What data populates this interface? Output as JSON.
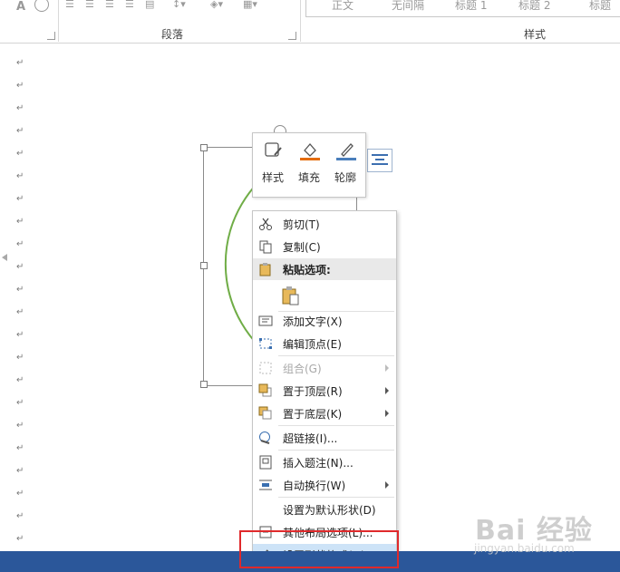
{
  "ribbon": {
    "paragraph_label": "段落",
    "styles_label": "样式",
    "style_items": [
      "正文",
      "无间隔",
      "标题 1",
      "标题 2",
      "标题"
    ]
  },
  "mini_toolbar": {
    "style_label": "样式",
    "fill_label": "填充",
    "outline_label": "轮廓",
    "fill_color": "#e46c0a",
    "outline_color": "#4a7ebb"
  },
  "context_menu": {
    "cut": "剪切(T)",
    "copy": "复制(C)",
    "paste_options": "粘贴选项:",
    "add_text": "添加文字(X)",
    "edit_points": "编辑顶点(E)",
    "group": "组合(G)",
    "bring_to_front": "置于顶层(R)",
    "send_to_back": "置于底层(K)",
    "hyperlink": "超链接(I)...",
    "insert_caption": "插入题注(N)...",
    "wrap_text": "自动换行(W)",
    "set_default_shape": "设置为默认形状(D)",
    "more_layout": "其他布局选项(L)...",
    "format_shape": "设置形状格式(O)..."
  },
  "colors": {
    "status_bar": "#2b579a",
    "highlight": "#e0292b",
    "shape_stroke": "#70ad47"
  },
  "watermark": {
    "brand": "Bai  经验",
    "url": "jingyan.baidu.com"
  }
}
